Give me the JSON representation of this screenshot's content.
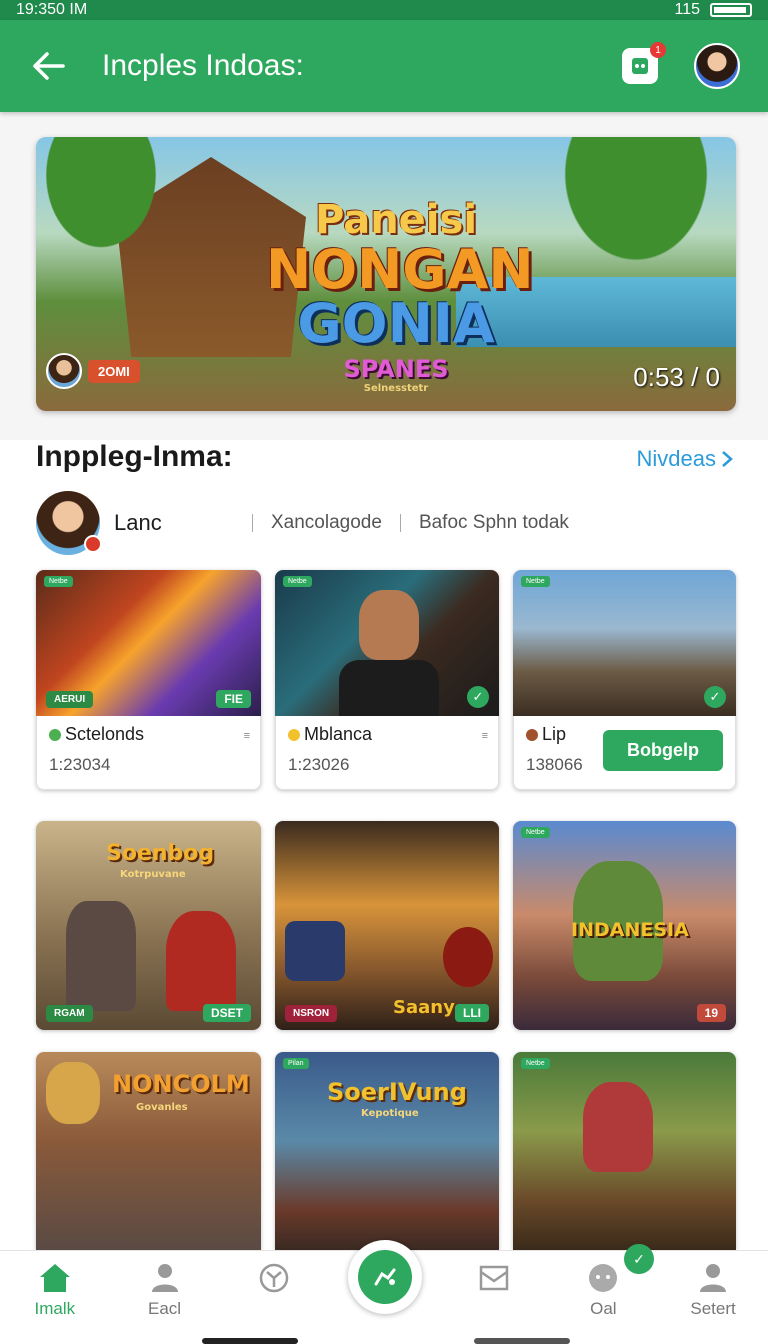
{
  "status_bar": {
    "time": "19:350 IM",
    "right_text": "115"
  },
  "app_bar": {
    "title": "Incples Indoas:",
    "notification_count": "1",
    "colors": {
      "bar": "#2fa85f"
    }
  },
  "hero": {
    "logo_line1": "Paneisi",
    "logo_line2": "NONGAN",
    "logo_line3": "GONIA",
    "logo_line4": "SPANES",
    "logo_line5": "Selnesstetr",
    "badge": "2OMI",
    "timer": "0:53 / 0"
  },
  "section": {
    "title": "Inppleg-Inma:",
    "see_all": "Nivdeas",
    "user_name": "Lanc",
    "meta1": "Xancolagode",
    "meta2": "Bafoc Sphn todak"
  },
  "cards_row1": [
    {
      "tag": "Netbe",
      "corner_left": "AERUI",
      "corner_right": "FIE",
      "name": "Sctelonds",
      "number": "1:23034",
      "icon": "leaf-icon"
    },
    {
      "tag": "Netbe",
      "name": "Mblanca",
      "number": "1:23026",
      "icon": "coin-icon"
    },
    {
      "tag": "Netbe",
      "name": "Lip",
      "number": "138066",
      "action": "Bobgelp",
      "icon": "bag-icon"
    }
  ],
  "cards_row2": [
    {
      "title": "Soenbog",
      "subtitle": "Kotrpuvane",
      "corner_left": "RGAM",
      "corner_right": "DSET"
    },
    {
      "title": "Saany",
      "corner_left": "NSRON",
      "corner_right": "LLI"
    },
    {
      "tag": "Netbe",
      "title": "INDANESIA",
      "corner_right": "19"
    }
  ],
  "cards_row3": [
    {
      "title": "NONCOLM",
      "subtitle": "Govanles"
    },
    {
      "tag": "Pilan",
      "title": "SoerIVung",
      "subtitle": "Kepotique"
    },
    {
      "tag": "Netbe"
    }
  ],
  "navbar": [
    {
      "label": "Imalk",
      "icon": "home-icon",
      "active": true
    },
    {
      "label": "Eacl",
      "icon": "profile-icon",
      "active": false
    },
    {
      "label": "",
      "icon": "compass-icon",
      "active": false
    },
    {
      "label": "",
      "icon": "mail-icon",
      "active": false
    },
    {
      "label": "Oal",
      "icon": "chat-icon",
      "active": false
    },
    {
      "label": "Setert",
      "icon": "user-icon",
      "active": false
    }
  ]
}
